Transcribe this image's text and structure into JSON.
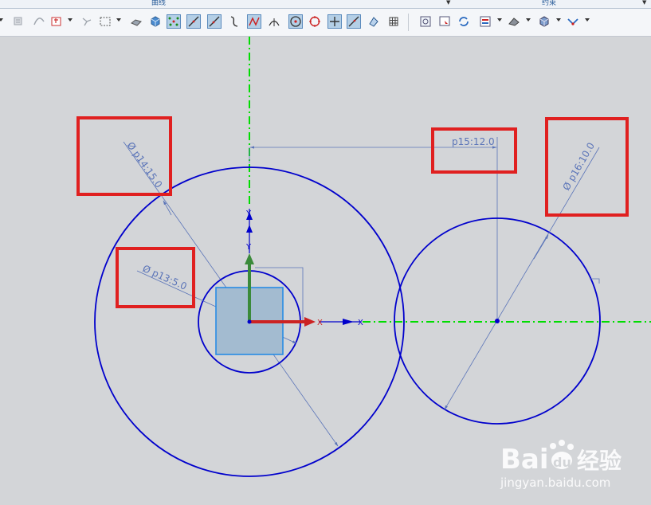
{
  "ribbon": {
    "group_curve": "曲线",
    "group_constraint": "约束"
  },
  "toolbar": {
    "icons": [
      "profile-icon",
      "derived-curve-icon",
      "trim-icon",
      "snap-point-icon",
      "rectangle-select-icon",
      "solid-shaded-icon",
      "cube-view-icon",
      "points-filter-icon",
      "line-icon",
      "line-alt-icon",
      "arc-icon",
      "spline-icon",
      "intersect-icon",
      "circle-center-icon",
      "circle-icon",
      "plus-point-icon",
      "slash-line-icon",
      "transform-icon",
      "grid-icon",
      "fit-view-icon",
      "view-orient-icon",
      "refresh-icon",
      "layer-icon",
      "edge-display-icon",
      "solid-view-icon",
      "snap-view-icon"
    ]
  },
  "canvas": {
    "background": "#d3d5d8",
    "sketch_color": "#0000cc",
    "dimension_color": "#5a74b8",
    "axis_color": "#00dd00",
    "highlight_color": "#e02020"
  },
  "dimensions": {
    "p14": "Ø p14:15.0",
    "p13": "Ø p13:5.0",
    "p15": "p15:12.0",
    "p16": "Ø p16:10.0"
  },
  "axes": {
    "x_label": "X",
    "y_label": "Y",
    "x_dir_label": "X",
    "y_dir_label": "Y"
  },
  "watermark": {
    "brand": "Bai",
    "brand_tail": "du",
    "chinese": "经验",
    "url": "jingyan.baidu.com"
  }
}
